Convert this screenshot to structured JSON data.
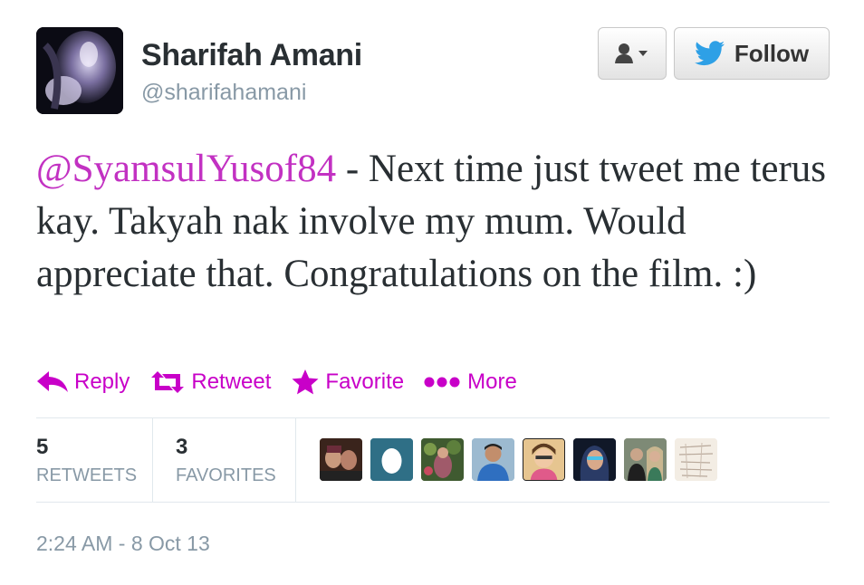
{
  "tweet": {
    "author": {
      "display_name": "Sharifah Amani",
      "username": "@sharifahamani"
    },
    "text": {
      "mention": "@SyamsulYusof84",
      "body": " - Next time just tweet me terus kay. Takyah nak involve my mum. Would appreciate that. Congratulations on the film. :)"
    },
    "buttons": {
      "user_menu_icon": "user-dropdown-icon",
      "follow_label": "Follow"
    },
    "actions": [
      {
        "label": "Reply",
        "icon": "reply-icon"
      },
      {
        "label": "Retweet",
        "icon": "retweet-icon"
      },
      {
        "label": "Favorite",
        "icon": "star-icon"
      },
      {
        "label": "More",
        "icon": "more-dots-icon"
      }
    ],
    "stats": {
      "retweets": {
        "count": "5",
        "label": "RETWEETS"
      },
      "favorites": {
        "count": "3",
        "label": "FAVORITES"
      }
    },
    "timestamp": "2:24 AM - 8 Oct 13"
  },
  "colors": {
    "accent": "#c800c8",
    "mention": "#c231c2",
    "muted": "#8899a6",
    "twitter_blue": "#2ea0e6"
  }
}
